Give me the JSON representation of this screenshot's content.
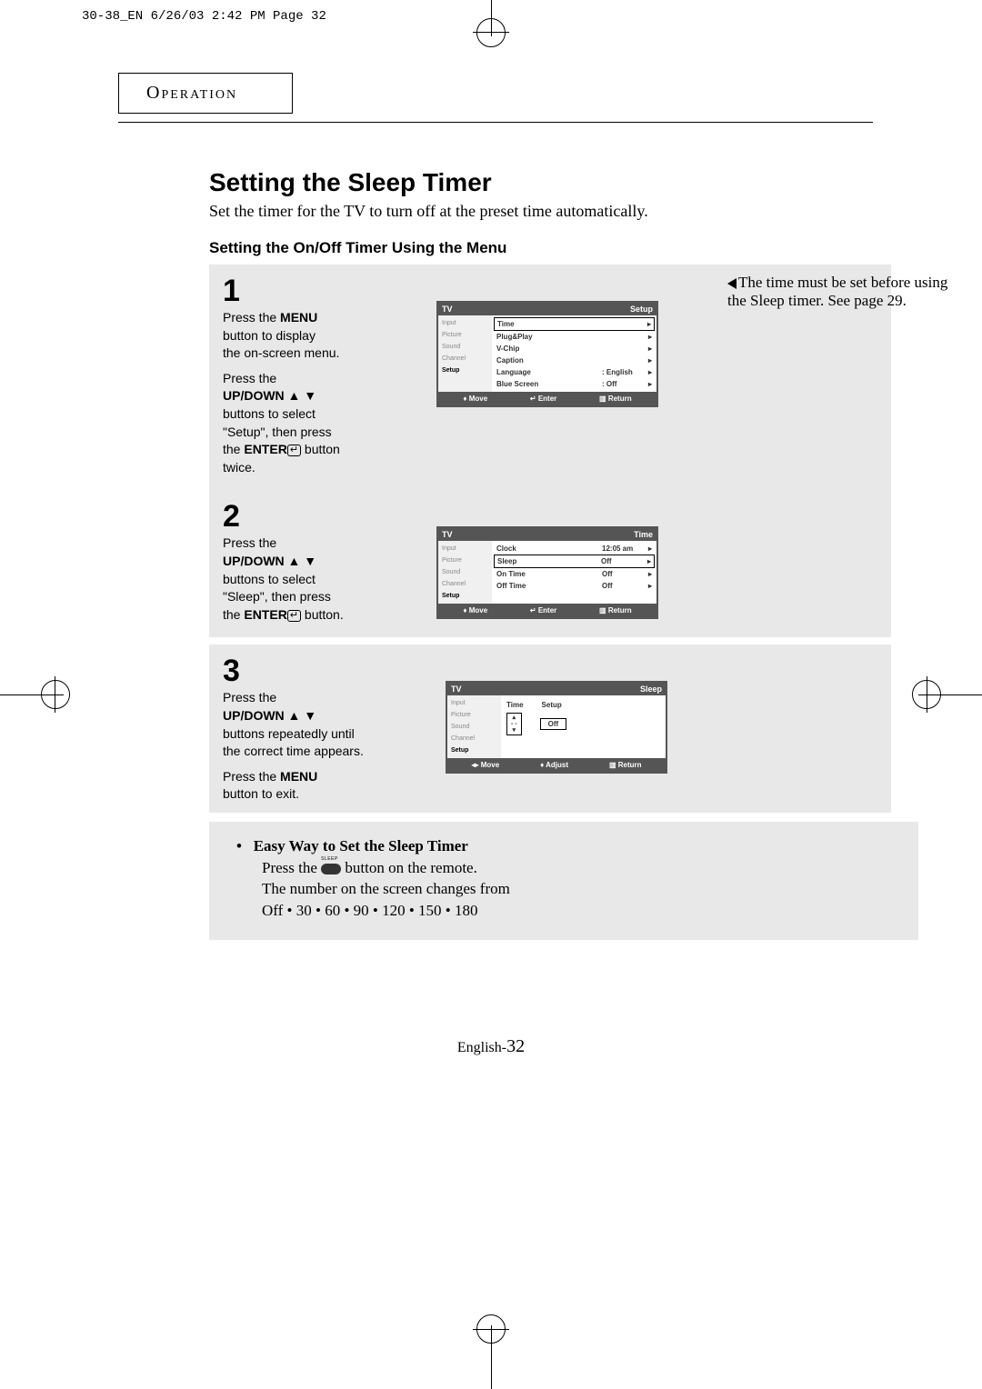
{
  "printmark": "30-38_EN  6/26/03 2:42 PM  Page 32",
  "section_label": "Operation",
  "heading": "Setting the Sleep Timer",
  "intro": "Set the timer for the TV to turn off at the preset time automatically.",
  "subheading": "Setting the On/Off  Timer Using the Menu",
  "side_note": "The time must be set before using the Sleep timer. See page 29.",
  "steps": {
    "one": {
      "num": "1",
      "line1a": "Press the ",
      "line1b": "MENU",
      "line2": "button to display",
      "line3": "the on-screen menu.",
      "line4a": "Press the",
      "line4b": "UP/DOWN",
      "line5": "buttons to select",
      "line6": "\"Setup\", then press",
      "line7a": "the ",
      "line7b": "ENTER",
      "line7c": "  button",
      "line8": "twice."
    },
    "two": {
      "num": "2",
      "line1a": "Press the",
      "line1b": "UP/DOWN",
      "line2": "buttons to select",
      "line3": "\"Sleep\", then press",
      "line4a": "the ",
      "line4b": "ENTER",
      "line4c": "  button."
    },
    "three": {
      "num": "3",
      "line1a": "Press the",
      "line1b": "UP/DOWN",
      "line2": "buttons repeatedly until",
      "line3": "the correct time appears.",
      "line4a": "Press the ",
      "line4b": "MENU",
      "line5": "button to exit."
    }
  },
  "osd1": {
    "title": "TV",
    "category": "Setup",
    "side": [
      "Input",
      "Picture",
      "Sound",
      "Channel",
      "Setup"
    ],
    "items": [
      {
        "label": "Time",
        "val": "",
        "sel": true
      },
      {
        "label": "Plug&Play",
        "val": ""
      },
      {
        "label": "V-Chip",
        "val": ""
      },
      {
        "label": "Caption",
        "val": ""
      },
      {
        "label": "Language",
        "val": ": English"
      },
      {
        "label": "Blue Screen",
        "val": ": Off"
      }
    ],
    "footer": {
      "move": "Move",
      "enter": "Enter",
      "return": "Return"
    }
  },
  "osd2": {
    "title": "TV",
    "category": "Time",
    "side": [
      "Input",
      "Picture",
      "Sound",
      "Channel",
      "Setup"
    ],
    "items": [
      {
        "label": "Clock",
        "val": "12:05 am"
      },
      {
        "label": "Sleep",
        "val": "Off",
        "sel": true
      },
      {
        "label": "On Time",
        "val": "Off"
      },
      {
        "label": "Off Time",
        "val": "Off"
      }
    ],
    "footer": {
      "move": "Move",
      "enter": "Enter",
      "return": "Return"
    }
  },
  "osd3": {
    "title": "TV",
    "category": "Sleep",
    "side": [
      "Input",
      "Picture",
      "Sound",
      "Channel",
      "Setup"
    ],
    "headers": {
      "time": "Time",
      "setup": "Setup"
    },
    "spinner": "- -",
    "value": "Off",
    "footer": {
      "move": "Move",
      "adjust": "Adjust",
      "return": "Return"
    }
  },
  "easy": {
    "title": "Easy Way to Set the Sleep Timer",
    "line1a": "Press the ",
    "line1b": " button on the remote.",
    "line2": "The number on the screen changes from",
    "line3": "Off • 30 • 60 • 90 • 120 • 150 • 180"
  },
  "footer": {
    "lang": "English-",
    "page": "32"
  }
}
